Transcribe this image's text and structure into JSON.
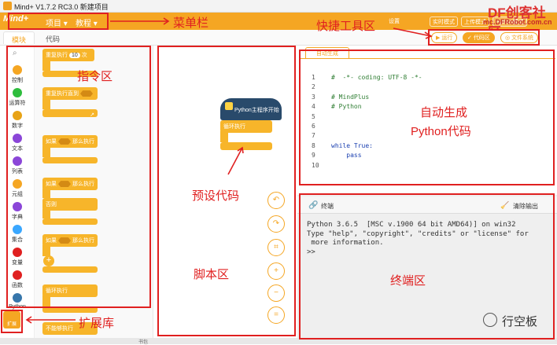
{
  "window": {
    "title": "Mind+ V1.7.2 RC3.0   新建项目"
  },
  "menubar": {
    "logo": "Mind+",
    "menus": [
      "项目 ▾",
      "教程 ▾"
    ],
    "right": [
      "实时模式",
      "上传模式",
      "Python模式"
    ],
    "settings_badge": "设置"
  },
  "left_tabs": {
    "tab1": "模块",
    "tab2": "代码"
  },
  "toolbar": {
    "run": "运行",
    "code": "代码区",
    "file": "文件系统",
    "project": "项目"
  },
  "watermark": {
    "line1": "DF创客社区",
    "line2": "mc.DFRobot.com.cn"
  },
  "categories": [
    {
      "label": "控制",
      "color": "#f5a623"
    },
    {
      "label": "运算符",
      "color": "#2ebd3d"
    },
    {
      "label": "数字",
      "color": "#e8a317"
    },
    {
      "label": "文本",
      "color": "#8b46d8"
    },
    {
      "label": "列表",
      "color": "#8b46d8"
    },
    {
      "label": "元组",
      "color": "#f5a623"
    },
    {
      "label": "字典",
      "color": "#8b46d8"
    },
    {
      "label": "集合",
      "color": "#3aa7ff"
    },
    {
      "label": "变量",
      "color": "#e02020"
    },
    {
      "label": "函数",
      "color": "#e02020"
    },
    {
      "label": "Python",
      "color": "#3776ab"
    }
  ],
  "extension": {
    "label": "扩展"
  },
  "blocks": {
    "repeat": "重复执行",
    "repeat_n": "10",
    "times": "次",
    "repeat_until": "重复执行直到",
    "if1": "如果",
    "then": "那么执行",
    "if2": "如果",
    "else_then": "那么执行",
    "else": "否则",
    "if3": "如果",
    "then3": "那么执行",
    "loop": "循环执行",
    "last": "不能够执行"
  },
  "workspace": {
    "python_start": "Python主程序开始",
    "loop": "循环执行"
  },
  "code": {
    "tab": "自动生成",
    "line_numbers": [
      "1",
      "2",
      "3",
      "4",
      "5",
      "6",
      "7",
      "8",
      "9",
      "10"
    ],
    "lines": [
      "#  -*- coding: UTF-8 -*-",
      "",
      "# MindPlus",
      "# Python",
      "",
      "",
      "",
      "while True:",
      "    pass",
      ""
    ]
  },
  "terminal": {
    "title": "终端",
    "clear": "清除输出",
    "lines": [
      "Python 3.6.5  [MSC v.1900 64 bit AMD64)] on win32",
      "Type \"help\", \"copyright\", \"credits\" or \"license\" for",
      " more information.",
      ">>"
    ]
  },
  "annotations": {
    "menubar": "菜单栏",
    "quick_tools": "快捷工具区",
    "blocks": "指令区",
    "preset": "预设代码",
    "script": "脚本区",
    "auto1": "自动生成",
    "auto2": "Python代码",
    "terminal": "终端区",
    "extension": "扩展库",
    "brand": "行空板"
  },
  "status": {
    "text": "书包"
  }
}
